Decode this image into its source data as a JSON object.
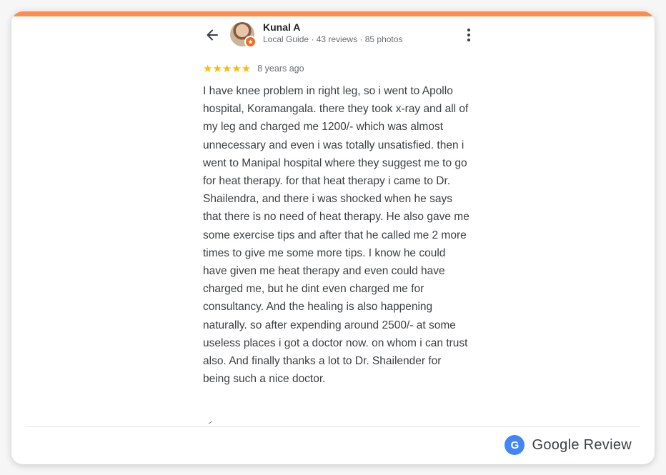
{
  "colors": {
    "accent_bar": "#ff8b4d",
    "star": "#fbbc04",
    "google_blue": "#4285f4",
    "local_guide_badge": "#f06b22"
  },
  "header": {
    "back_icon": "arrow-left-icon",
    "reviewer_name": "Kunal A",
    "reviewer_meta": "Local Guide · 43 reviews · 85 photos",
    "more_icon": "more-vertical-icon"
  },
  "review": {
    "stars": "★★★★★",
    "rating": 5,
    "rating_max": 5,
    "time_ago": "8 years ago",
    "text": "I have knee problem in right leg, so i went to Apollo hospital, Koramangala. there they took x-ray and all of my leg and charged me 1200/- which was almost unnecessary and even i was totally unsatisfied. then i went to Manipal hospital where they suggest me to go for heat therapy. for that heat therapy i came to Dr. Shailendra, and there i was shocked when he says that there is no need of heat therapy. He also gave me some exercise tips and after that he called me 2 more times to give me some more tips. I know he could have given me heat therapy and even could have charged me, but he dint even charged me for consultancy. And the healing is also happening naturally. so after expending around 2500/- at some useless places i got a doctor now. on whom i can trust also. And finally thanks a lot to Dr. Shailender for being such a nice doctor."
  },
  "footer": {
    "logo_letter": "G",
    "label": "Google Review"
  }
}
